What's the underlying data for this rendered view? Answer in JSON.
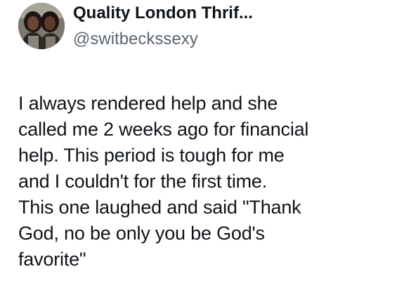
{
  "author": {
    "display_name": "Quality London Thrif...",
    "handle": "@switbeckssexy",
    "avatar": "profile-photo"
  },
  "tweet": {
    "lines": [
      "I always rendered help and she",
      "called me 2 weeks ago for financial",
      "help. This period is tough for me",
      "and I couldn't for the first time.",
      "This one laughed and said \"Thank",
      "God, no be only you be God's",
      "favorite\""
    ]
  }
}
